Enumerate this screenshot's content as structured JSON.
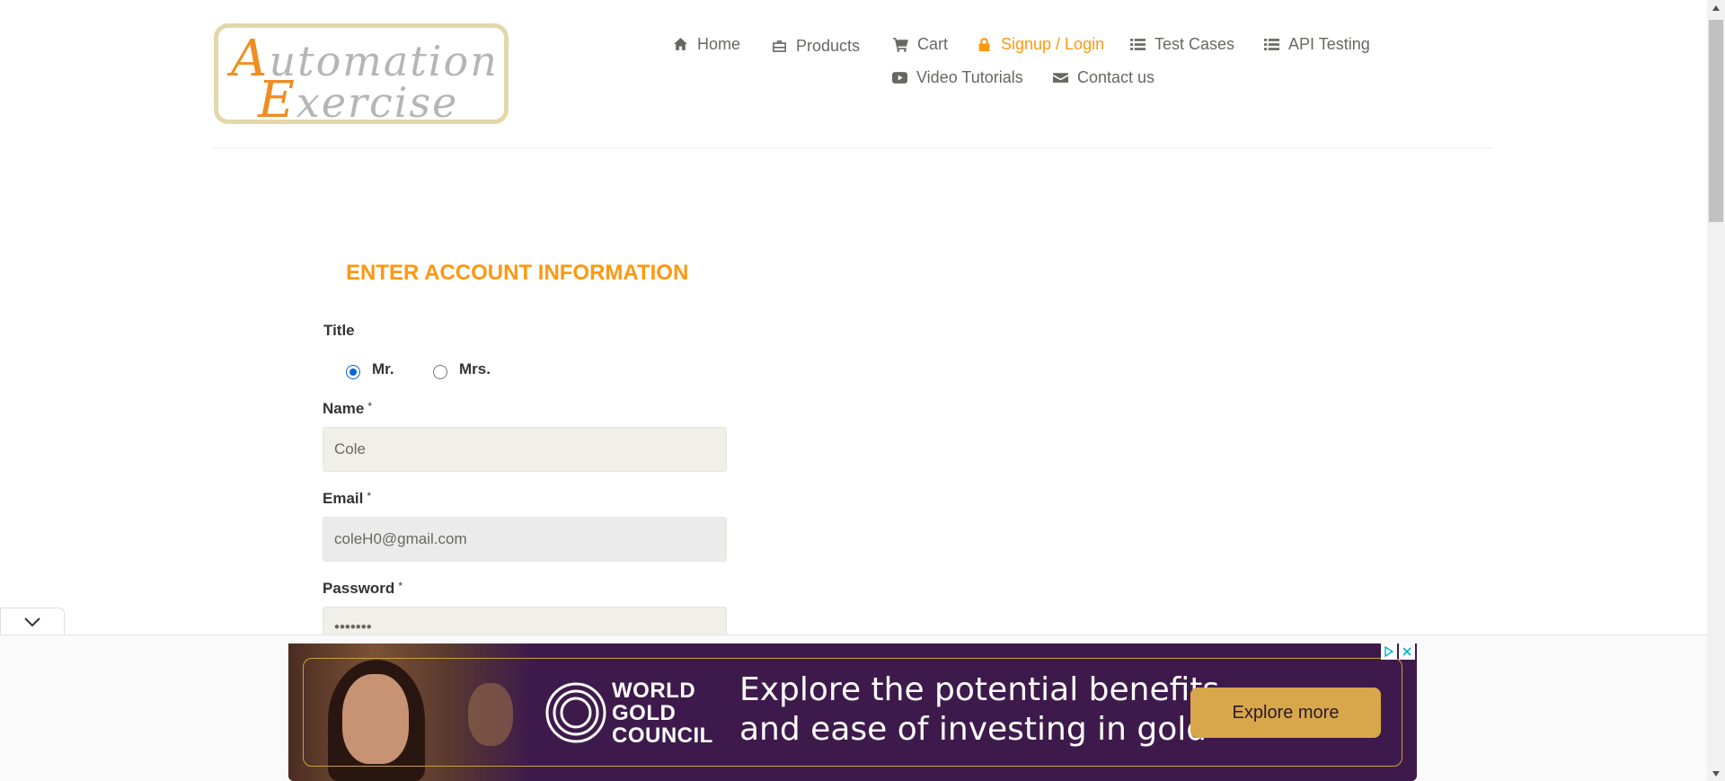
{
  "logo": {
    "line1_cap": "A",
    "line1_rest": "utomation",
    "line2_cap": "E",
    "line2_rest": "xercise"
  },
  "nav": {
    "home": "Home",
    "products": "Products",
    "cart": "Cart",
    "signup": "Signup / Login",
    "test_cases": "Test Cases",
    "api_testing": "API Testing",
    "video_tutorials": "Video Tutorials",
    "contact": "Contact us"
  },
  "form": {
    "heading": "ENTER ACCOUNT INFORMATION",
    "title_label": "Title",
    "title_options": [
      "Mr.",
      "Mrs."
    ],
    "title_selected": "Mr.",
    "required_mark": "*",
    "name_label": "Name",
    "name_value": "Cole",
    "email_label": "Email",
    "email_value": "coleH0@gmail.com",
    "password_label": "Password",
    "password_value": "•••••••"
  },
  "ad": {
    "brand_line1": "WORLD",
    "brand_line2": "GOLD",
    "brand_line3": "COUNCIL",
    "copy_line1": "Explore the potential benefits",
    "copy_line2": "and ease of investing in gold",
    "cta": "Explore more"
  },
  "colors": {
    "accent": "#fe980f",
    "text": "#696763",
    "ad_background": "#3e1a4c",
    "ad_button": "#d8a74a",
    "radio_selected": "#0a66d6"
  },
  "icons": {
    "home": "home-icon",
    "products": "briefcase-icon",
    "cart": "cart-icon",
    "signup": "lock-icon",
    "test_cases": "list-icon",
    "api_testing": "list-icon",
    "video": "youtube-play-icon",
    "contact": "envelope-icon"
  }
}
